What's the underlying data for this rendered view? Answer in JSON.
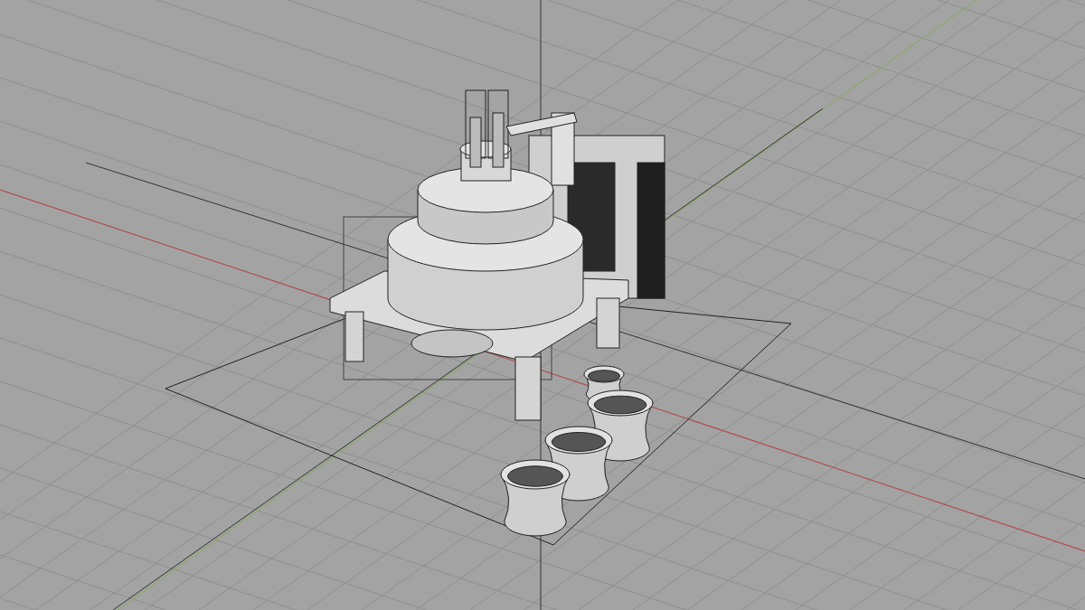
{
  "viewport": {
    "grid_visible": true,
    "world_axes_visible": true
  }
}
